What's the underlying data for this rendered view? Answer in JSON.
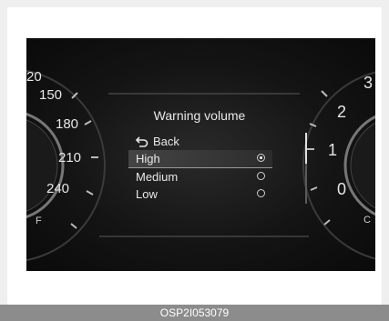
{
  "speedometer": {
    "ticks": [
      "20",
      "150",
      "180",
      "210",
      "240",
      "F"
    ]
  },
  "tachometer": {
    "ticks": [
      "3",
      "2",
      "1",
      "0",
      "C"
    ]
  },
  "menu": {
    "title": "Warning volume",
    "back_label": "Back",
    "items": [
      {
        "label": "High",
        "selected": true
      },
      {
        "label": "Medium",
        "selected": false
      },
      {
        "label": "Low",
        "selected": false
      }
    ],
    "scroll_position": 0.0
  },
  "caption": "OSP2I053079",
  "colors": {
    "background": "#0a0a0a",
    "text": "#e8e8e8",
    "caption_bar": "#8c8c8c"
  },
  "icons": [
    "back-arrow-icon",
    "radio-selected-icon",
    "radio-empty-icon"
  ]
}
